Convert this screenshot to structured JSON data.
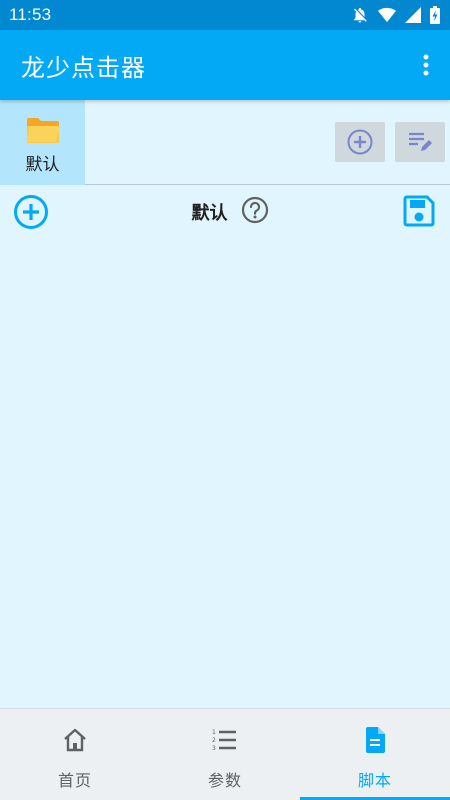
{
  "status_bar": {
    "time": "11:53",
    "icons": [
      "notifications-off-icon",
      "wifi-icon",
      "cell-signal-icon",
      "battery-charging-icon"
    ]
  },
  "app_bar": {
    "title": "龙少点击器",
    "menu_icon": "more-vert-icon"
  },
  "groups": {
    "items": [
      {
        "label": "默认",
        "icon": "folder-icon",
        "selected": true
      }
    ],
    "add_icon": "add-circle-icon",
    "edit_icon": "edit-list-icon"
  },
  "script": {
    "title": "默认",
    "add_icon": "add-circle-icon",
    "help_icon": "help-icon",
    "save_icon": "save-icon"
  },
  "bottom_nav": {
    "items": [
      {
        "label": "首页",
        "icon": "home-icon",
        "active": false
      },
      {
        "label": "参数",
        "icon": "list-numbered-icon",
        "active": false
      },
      {
        "label": "脚本",
        "icon": "document-icon",
        "active": true
      }
    ]
  },
  "colors": {
    "status_bar": "#0288d1",
    "app_bar": "#03a9f4",
    "background": "#e1f5fe",
    "selected_tab": "#b3e5fc",
    "accent": "#03a9f4",
    "tool_button": "#cfd8dc",
    "tool_icon": "#7986cb"
  }
}
